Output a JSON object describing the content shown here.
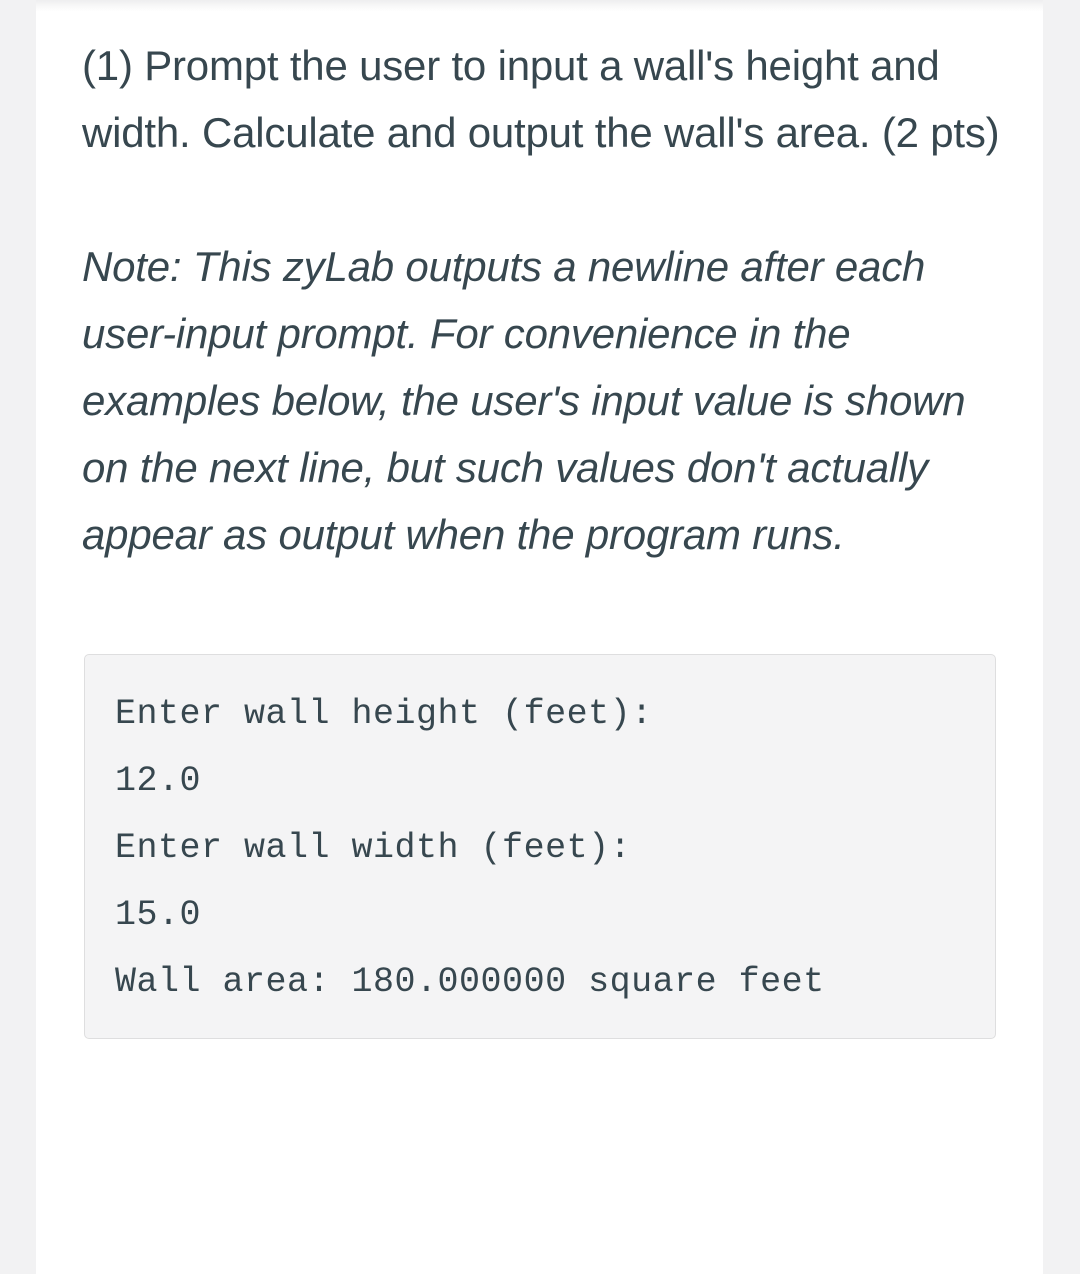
{
  "page": {
    "background_color": "#f2f2f3",
    "card_color": "#ffffff",
    "text_color": "#37474f"
  },
  "exercise": {
    "prompt": "(1) Prompt the user to input a wall's height and width. Calculate and output the wall's area. (2 pts)",
    "note": "Note: This zyLab outputs a newline after each user-input prompt. For convenience in the examples below, the user's input value is shown on the next line, but such values don't actually appear as output when the program runs."
  },
  "example_output": {
    "background_color": "#f4f4f5",
    "border_color": "#dededf",
    "lines": [
      "Enter wall height (feet):",
      "12.0",
      "Enter wall width (feet):",
      "15.0",
      "Wall area: 180.000000 square feet"
    ],
    "text": "Enter wall height (feet):\n12.0\nEnter wall width (feet):\n15.0\nWall area: 180.000000 square feet"
  }
}
